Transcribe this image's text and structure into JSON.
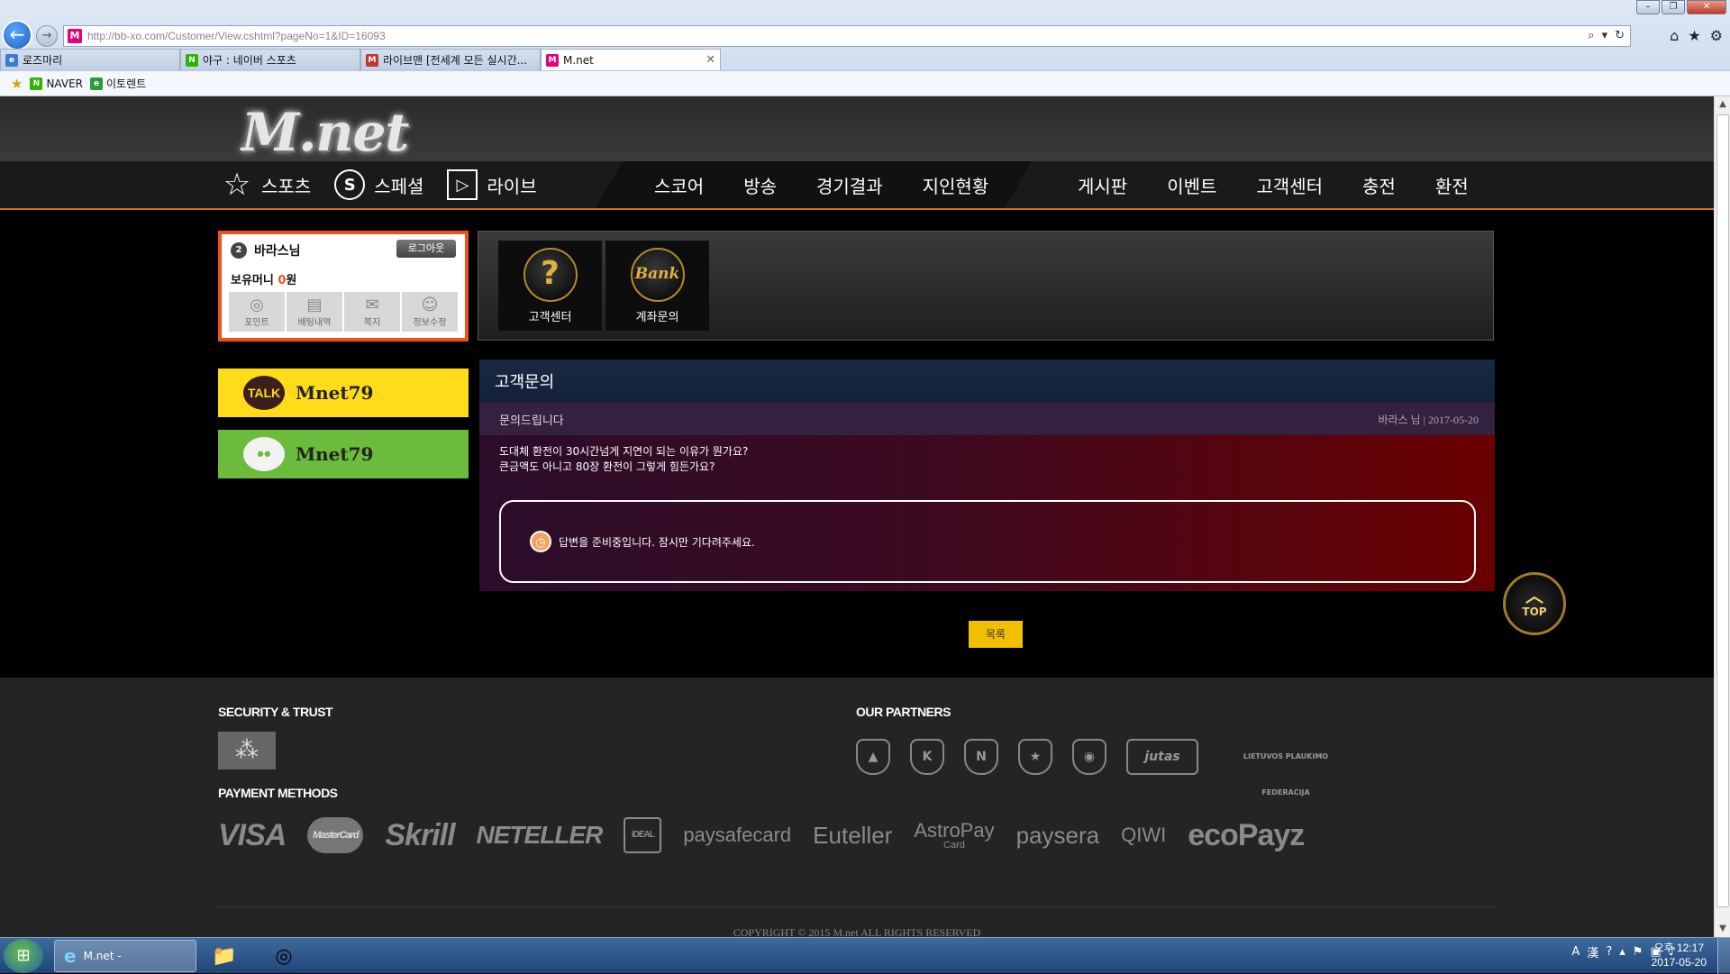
{
  "browser": {
    "url": "http://bb-xo.com/Customer/View.cshtml?pageNo=1&ID=16093",
    "tabs": [
      {
        "label": "로즈마리",
        "favicon": "e"
      },
      {
        "label": "야구 : 네이버 스포츠",
        "favicon": "N"
      },
      {
        "label": "라이브맨 [전세계 모든 실시간...",
        "favicon": "M"
      },
      {
        "label": "M.net",
        "favicon": "M"
      }
    ],
    "favorites": [
      {
        "label": "NAVER"
      },
      {
        "label": "이토렌트"
      }
    ]
  },
  "site": {
    "logo": "M.net",
    "nav_left": [
      {
        "label": "스포츠",
        "icon": "star-icon"
      },
      {
        "label": "스페셜",
        "icon": "s-circle-icon"
      },
      {
        "label": "라이브",
        "icon": "monitor-icon"
      }
    ],
    "nav_mid": [
      "스코어",
      "방송",
      "경기결과",
      "지인현황"
    ],
    "nav_right": [
      "게시판",
      "이벤트",
      "고객센터",
      "충전",
      "환전"
    ]
  },
  "user": {
    "name": "바라스님",
    "logout_label": "로그아웃",
    "money_label": "보유머니",
    "money_value": "0",
    "money_unit": "원",
    "actions": [
      "포인트",
      "배팅내역",
      "쪽지",
      "정보수정"
    ]
  },
  "quick": [
    {
      "label": "고객센터",
      "icon_text": "?"
    },
    {
      "label": "계좌문의",
      "icon_text": "Bank"
    }
  ],
  "messengers": [
    {
      "name": "Mnet79",
      "badge": "TALK"
    },
    {
      "name": "Mnet79",
      "badge": "••"
    }
  ],
  "inquiry": {
    "header": "고객문의",
    "subject": "문의드립니다",
    "meta": "바라스 님 | 2017-05-20",
    "body_lines": [
      "도대체 환전이 30시간넘게 지연이 되는 이유가 뭔가요?",
      "큰금액도 아니고 80장 환전이 그렇게 힘든가요?"
    ],
    "reply": "답변을 준비중입니다. 잠시만 기다려주세요.",
    "list_label": "목록"
  },
  "top_button": "TOP",
  "footer": {
    "security_title": "SECURITY & TRUST",
    "partners_title": "OUR PARTNERS",
    "partners_last": "LIETUVOS PLAUKIMO FEDERACIJA",
    "payments_title": "PAYMENT METHODS",
    "payments": [
      "VISA",
      "MasterCard",
      "Skrill",
      "NETELLER",
      "iDEAL",
      "paysafecard",
      "Euteller",
      "AstroPay",
      "paysera",
      "QIWI",
      "ecoPayz"
    ],
    "astropay_sub": "Card",
    "copyright": "COPYRIGHT © 2015 M.net ALL RIGHTS RESERVED"
  },
  "taskbar": {
    "app_label": "M.net -",
    "clock_time": "오후 12:17",
    "clock_date": "2017-05-20"
  }
}
